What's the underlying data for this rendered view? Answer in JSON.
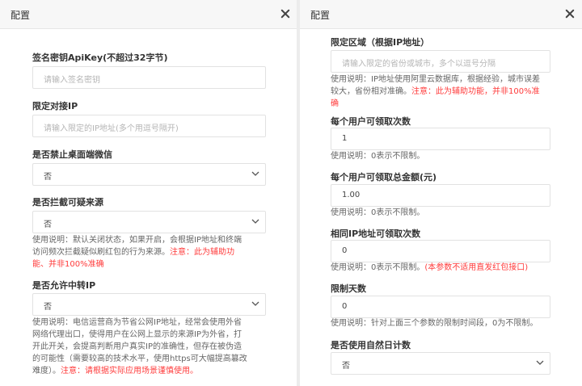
{
  "left_panel": {
    "title": "配置",
    "fields": {
      "apikey": {
        "label": "签名密钥ApiKey(不超过32字节)",
        "placeholder": "请输入签名密钥"
      },
      "ip": {
        "label": "限定对接IP",
        "placeholder": "请输入限定的IP地址(多个用逗号隔开)"
      },
      "wechat": {
        "label": "是否禁止桌面端微信",
        "value": "否"
      },
      "intercept": {
        "label": "是否拦截可疑来源",
        "value": "否",
        "hint_lines": [
          "使用说明：默认关闭状态，如果开启，会根据IP地址和终端",
          "访问频次拦截疑似刷红包的行为来源。"
        ],
        "hint_warn_inline": "注意：此为辅助功",
        "hint_warn_line": "能、并非100%准确"
      },
      "proxy": {
        "label": "是否允许中转IP",
        "value": "否",
        "hint_lines": [
          "使用说明：电信运营商为节省公网IP地址，经常会使用外省",
          "网络代理出口，使得用户在公网上显示的来源IP为外省，打",
          "开此开关，会提高判断用户真实IP的准确性，但存在被伪造",
          "的可能性（需要较高的技术水平，使用https可大幅提高篡改"
        ],
        "hint_last": "难度）。",
        "hint_warn": "注意：请根据实际应用场景谨慎使用。"
      }
    }
  },
  "right_panel": {
    "title": "配置",
    "fields": {
      "region": {
        "label": "限定区域（根据IP地址）",
        "placeholder": "请输入限定的省份或城市，多个以逗号分隔",
        "hint_line1": "使用说明：IP地址使用阿里云数据库，根据经验，城市误差",
        "hint_line2": "较大，省份相对准确。",
        "hint_warn1": "注意：此为辅助功能，并非100%准",
        "hint_warn2": "确"
      },
      "times": {
        "label": "每个用户可领取次数",
        "value": "1",
        "hint": "使用说明：0表示不限制。"
      },
      "amount": {
        "label": "每个用户可领取总金额(元)",
        "value": "1.00",
        "hint": "使用说明：0表示不限制。"
      },
      "sameip": {
        "label": "相同IP地址可领取次数",
        "value": "0",
        "hint": "使用说明：0表示不限制。",
        "hint_warn": "(本参数不适用直发红包接口)"
      },
      "days": {
        "label": "限制天数",
        "value": "0",
        "hint": "使用说明：针对上面三个参数的限制时间段，0为不限制。"
      },
      "natural": {
        "label": "是否使用自然日计数",
        "value": "否"
      }
    }
  }
}
